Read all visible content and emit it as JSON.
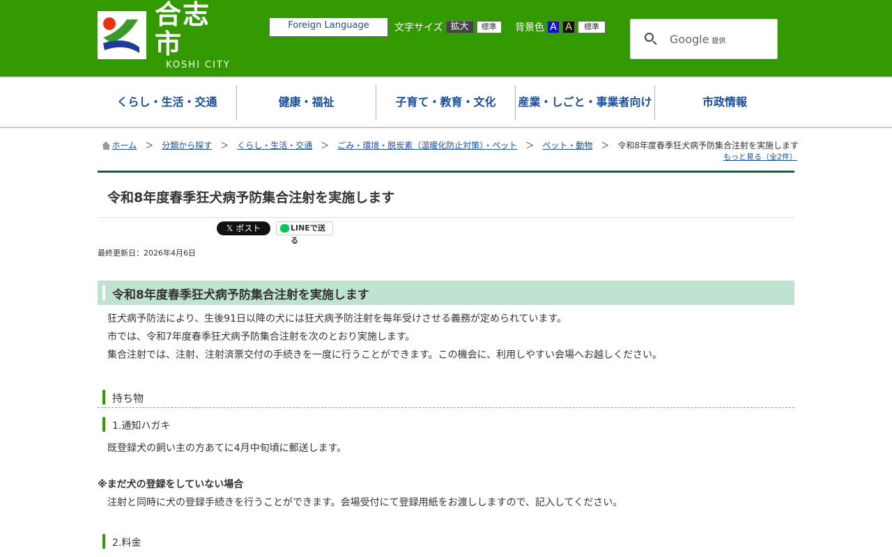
{
  "header": {
    "logo_text": "合志市",
    "logo_sub": "KOSHI CITY",
    "foreign_language": "Foreign Language",
    "font_size_label": "文字サイズ",
    "font_size_enlarge": "拡大",
    "font_size_standard": "標準",
    "bg_color_label": "背景色",
    "bg_blue": "A",
    "bg_black": "A",
    "bg_standard": "標準",
    "search_brand": "Google",
    "search_brand_suffix": "提供",
    "colors": {
      "header_bg": "#339900",
      "nav_text": "#1a4d99"
    }
  },
  "nav": {
    "items": [
      {
        "label": "くらし・生活・交通"
      },
      {
        "label": "健康・福祉"
      },
      {
        "label": "子育て・教育・文化"
      },
      {
        "label": "産業・しごと・事業者向け"
      },
      {
        "label": "市政情報"
      }
    ]
  },
  "breadcrumb": {
    "items": [
      {
        "label": "ホーム"
      },
      {
        "label": "分類から探す"
      },
      {
        "label": "くらし・生活・交通"
      },
      {
        "label": "ごみ・環境・脱炭素（温暖化防止対策）・ペット"
      },
      {
        "label": "ペット・動物"
      }
    ],
    "separator": "＞",
    "current": "令和8年度春季狂犬病予防集合注射を実施します",
    "more": "もっと見る（全2件）"
  },
  "page": {
    "title": "令和8年度春季狂犬病予防集合注射を実施します",
    "share_x": "𝕏 ポスト",
    "share_line": "LINEで送る",
    "updated": "最終更新日：2026年4月6日"
  },
  "content": {
    "h2": "令和8年度春季狂犬病予防集合注射を実施します",
    "intro": [
      "狂犬病予防法により、生後91日以降の犬には狂犬病予防注射を毎年受けさせる義務が定められています。",
      "市では、令和7年度春季狂犬病予防集合注射を次のとおり実施します。",
      "集合注射では、注射、注射済票交付の手続きを一度に行うことができます。この機会に、利用しやすい会場へお越しください。"
    ],
    "h3_items": "持ち物",
    "h4_postcard": "1.通知ハガキ",
    "postcard_text": "既登録犬の飼い主の方あてに4月中旬頃に郵送します。",
    "unregistered_title": "※まだ犬の登録をしていない場合",
    "unregistered_text": "注射と同時に犬の登録手続きを行うことができます。会場受付にて登録用紙をお渡ししますので、記入してください。",
    "h4_fee": "2.料金"
  }
}
